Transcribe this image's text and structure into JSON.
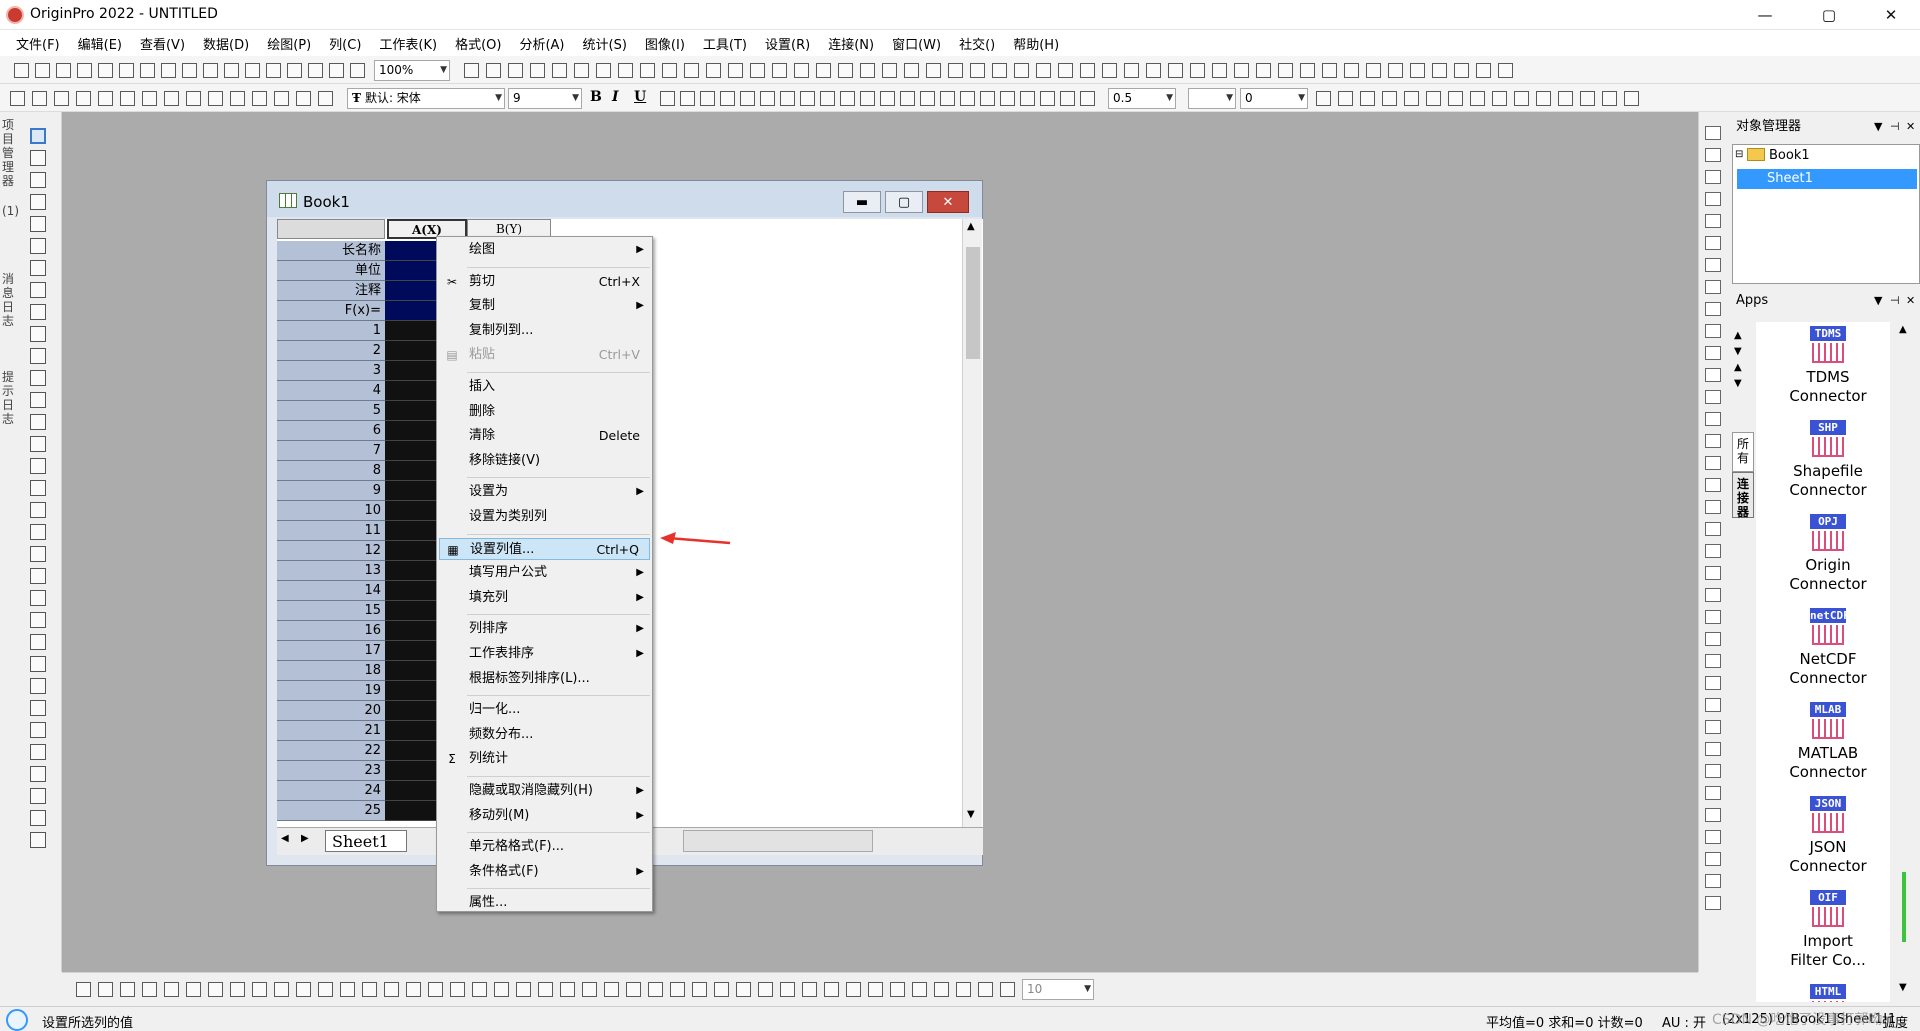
{
  "window": {
    "title": "OriginPro 2022 - UNTITLED",
    "minimize": "—",
    "maximize": "▢",
    "close": "✕"
  },
  "menu": [
    "文件(F)",
    "编辑(E)",
    "查看(V)",
    "数据(D)",
    "绘图(P)",
    "列(C)",
    "工作表(K)",
    "格式(O)",
    "分析(A)",
    "统计(S)",
    "图像(I)",
    "工具(T)",
    "设置(R)",
    "连接(N)",
    "窗口(W)",
    "社交()",
    "帮助(H)"
  ],
  "toolbar": {
    "zoom": "100%",
    "font": "默认: 宋体",
    "font_size": "9",
    "line_width": "0.5",
    "value_box": "0",
    "bold": "B",
    "italic": "I",
    "underline": "U",
    "bottom_zoom": "10"
  },
  "left_panel_labels": [
    "项目管理器",
    "(1)",
    "消息日志",
    "提示日志"
  ],
  "book": {
    "title": "Book1",
    "col_a": "A(X)",
    "col_b": "B(Y)",
    "meta_rows": [
      "长名称",
      "单位",
      "注释",
      "F(x)="
    ],
    "rows": [
      "1",
      "2",
      "3",
      "4",
      "5",
      "6",
      "7",
      "8",
      "9",
      "10",
      "11",
      "12",
      "13",
      "14",
      "15",
      "16",
      "17",
      "18",
      "19",
      "20",
      "21",
      "22",
      "23",
      "24",
      "25"
    ],
    "sheet_tab": "Sheet1"
  },
  "context_menu": [
    {
      "label": "绘图",
      "shortcut": "",
      "submenu": true,
      "icon": ""
    },
    {
      "sep": true
    },
    {
      "label": "剪切",
      "shortcut": "Ctrl+X",
      "icon": "✂"
    },
    {
      "label": "复制",
      "shortcut": "",
      "submenu": true
    },
    {
      "label": "复制列到...",
      "shortcut": ""
    },
    {
      "label": "粘贴",
      "shortcut": "Ctrl+V",
      "disabled": true,
      "icon": "▤"
    },
    {
      "sep": true
    },
    {
      "label": "插入",
      "shortcut": ""
    },
    {
      "label": "删除",
      "shortcut": ""
    },
    {
      "label": "清除",
      "shortcut": "Delete"
    },
    {
      "label": "移除链接(V)",
      "shortcut": ""
    },
    {
      "sep": true
    },
    {
      "label": "设置为",
      "shortcut": "",
      "submenu": true
    },
    {
      "label": "设置为类别列",
      "shortcut": ""
    },
    {
      "sep": true
    },
    {
      "label": "设置列值...",
      "shortcut": "Ctrl+Q",
      "highlight": true,
      "icon": "▦"
    },
    {
      "label": "填写用户公式",
      "shortcut": "",
      "submenu": true
    },
    {
      "label": "填充列",
      "shortcut": "",
      "submenu": true
    },
    {
      "sep": true
    },
    {
      "label": "列排序",
      "shortcut": "",
      "submenu": true
    },
    {
      "label": "工作表排序",
      "shortcut": "",
      "submenu": true
    },
    {
      "label": "根据标签列排序(L)...",
      "shortcut": ""
    },
    {
      "sep": true
    },
    {
      "label": "归一化...",
      "shortcut": ""
    },
    {
      "label": "频数分布...",
      "shortcut": ""
    },
    {
      "label": "列统计",
      "shortcut": "",
      "icon": "Σ"
    },
    {
      "sep": true
    },
    {
      "label": "隐藏或取消隐藏列(H)",
      "shortcut": "",
      "submenu": true
    },
    {
      "label": "移动列(M)",
      "shortcut": "",
      "submenu": true
    },
    {
      "sep": true
    },
    {
      "label": "单元格格式(F)...",
      "shortcut": ""
    },
    {
      "label": "条件格式(F)",
      "shortcut": "",
      "submenu": true
    },
    {
      "sep": true
    },
    {
      "label": "属性...",
      "shortcut": ""
    }
  ],
  "object_manager": {
    "title": "对象管理器",
    "book": "Book1",
    "sheet": "Sheet1"
  },
  "apps": {
    "title": "Apps",
    "tabs": [
      "所有",
      "连接器"
    ],
    "items": [
      {
        "tag": "TDMS",
        "name1": "TDMS",
        "name2": "Connector"
      },
      {
        "tag": "SHP",
        "name1": "Shapefile",
        "name2": "Connector"
      },
      {
        "tag": "OPJ",
        "name1": "Origin",
        "name2": "Connector"
      },
      {
        "tag": "netCDF",
        "name1": "NetCDF",
        "name2": "Connector"
      },
      {
        "tag": "MLAB",
        "name1": "MATLAB",
        "name2": "Connector"
      },
      {
        "tag": "JSON",
        "name1": "JSON",
        "name2": "Connector"
      },
      {
        "tag": "OIF",
        "name1": "Import",
        "name2": "Filter Co..."
      },
      {
        "tag": "HTML",
        "name1": "",
        "name2": ""
      }
    ]
  },
  "status": {
    "left": "设置所选列的值",
    "stats": "平均值=0 求和=0 计数=0",
    "au": "AU : 开",
    "cell": "(2x125) 0",
    "book": "[Book1]Sheet1!1",
    "angle": "弧度",
    "watermark": "CSDN @吃饱了没事打郭呦"
  },
  "colors": {
    "accent": "#3399ff",
    "highlight": "#cde6f7",
    "arrow": "#e8312a"
  }
}
